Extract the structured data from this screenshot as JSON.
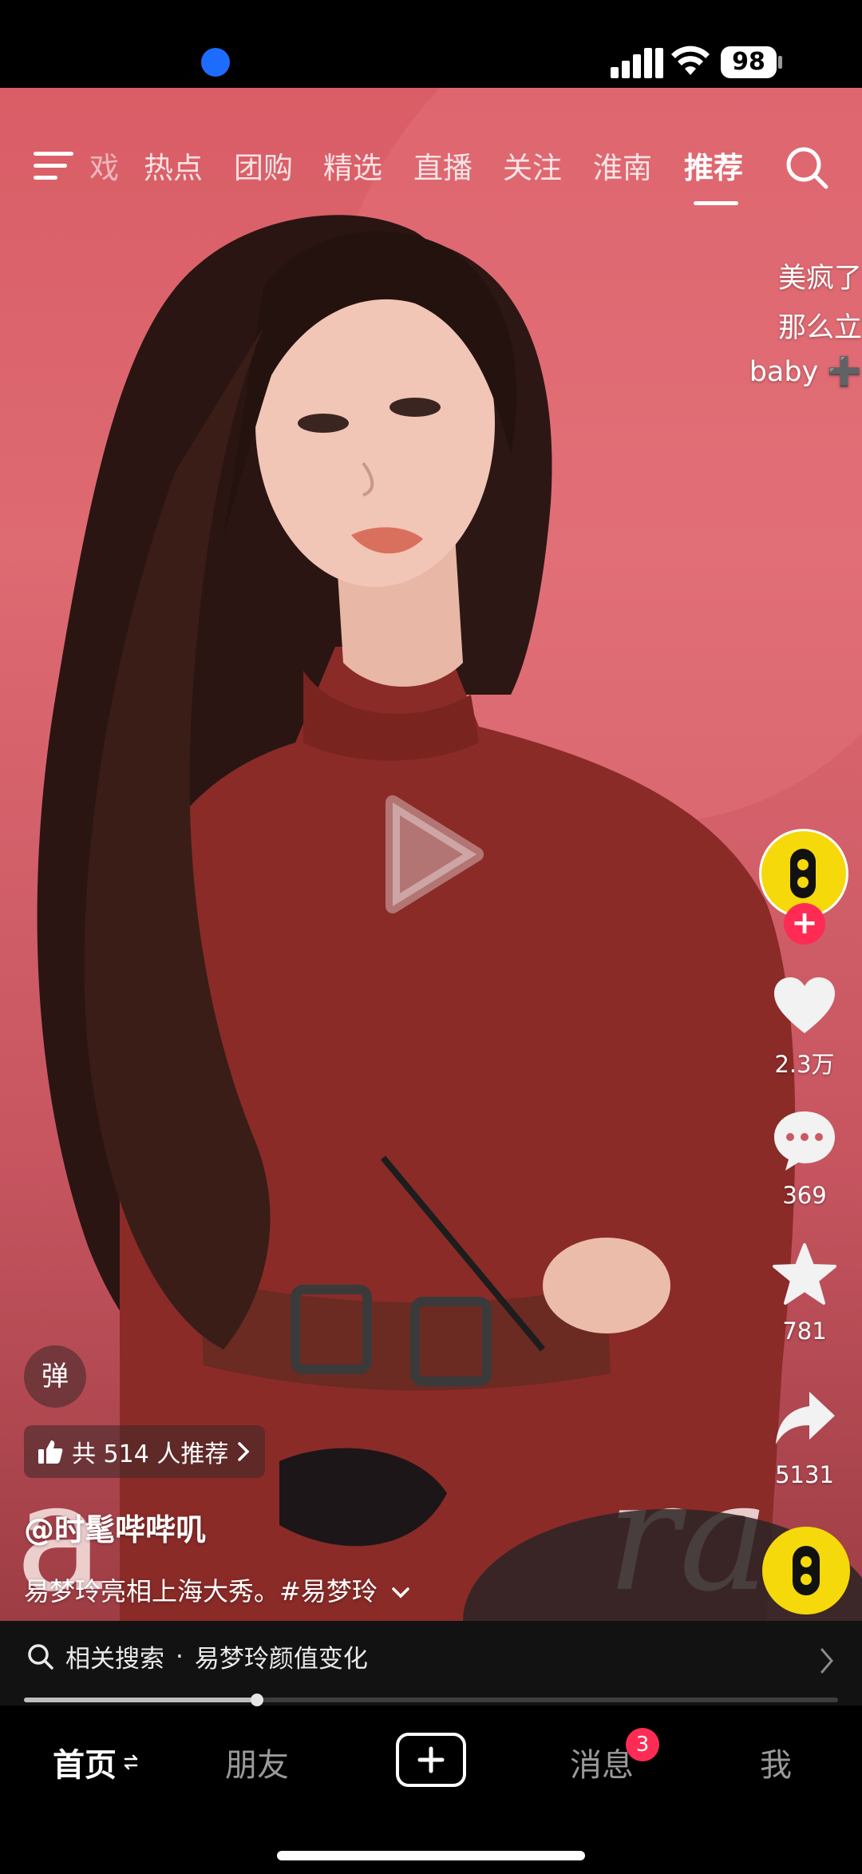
{
  "status_bar": {
    "battery": "98"
  },
  "top_nav": {
    "tabs": [
      "戏",
      "热点",
      "团购",
      "精选",
      "直播",
      "关注",
      "淮南",
      "推荐"
    ],
    "active_tab": "推荐"
  },
  "danmaku": [
    "美疯了",
    "那么立",
    "baby ➕"
  ],
  "actions": {
    "likes": "2.3万",
    "comments": "369",
    "favorites": "781",
    "shares": "5131"
  },
  "danmu_toggle": "弹",
  "recommend": {
    "text": "共 514 人推荐"
  },
  "author": "@时髦哔哔叽",
  "caption": "易梦玲亮相上海大秀。#易梦玲",
  "related_search": {
    "prefix": "相关搜索",
    "separator": "·",
    "query": "易梦玲颜值变化"
  },
  "progress": {
    "fraction": 0.286
  },
  "bottom_tabs": {
    "home": "首页",
    "friends": "朋友",
    "messages": "消息",
    "messages_badge": "3",
    "me": "我"
  },
  "colors": {
    "accent": "#fe2c55",
    "avatar": "#f5d90a",
    "background": "#d95d66"
  }
}
